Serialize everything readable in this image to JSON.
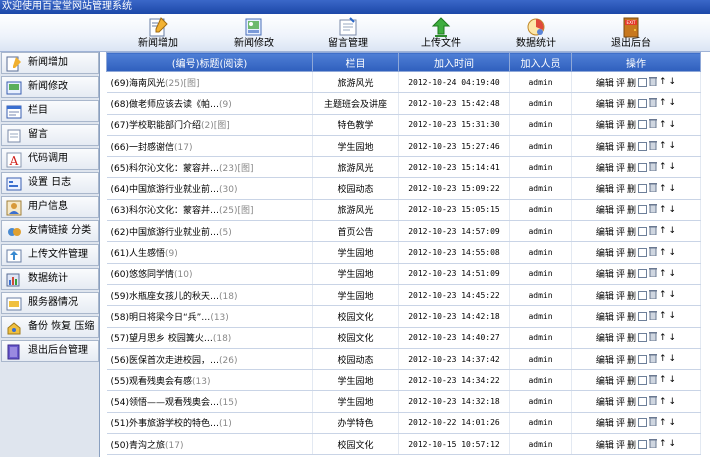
{
  "window": {
    "title": "欢迎使用百宝堂网站管理系统"
  },
  "toolbar": [
    {
      "label": "新闻增加",
      "icon": "news-add-icon"
    },
    {
      "label": "新闻修改",
      "icon": "news-edit-icon"
    },
    {
      "label": "留言管理",
      "icon": "message-icon"
    },
    {
      "label": "上传文件",
      "icon": "upload-icon"
    },
    {
      "label": "数据统计",
      "icon": "stats-icon"
    },
    {
      "label": "退出后台",
      "icon": "exit-icon",
      "badge": "EXIT"
    }
  ],
  "sidebar": [
    {
      "label": "新闻增加",
      "icon": "news-add-icon"
    },
    {
      "label": "新闻修改",
      "icon": "news-edit-icon"
    },
    {
      "label": "栏目",
      "icon": "category-icon"
    },
    {
      "label": "留言",
      "icon": "message-icon"
    },
    {
      "label": "代码调用",
      "icon": "code-icon"
    },
    {
      "label": "设置 日志",
      "icon": "settings-icon"
    },
    {
      "label": "用户信息",
      "icon": "user-icon"
    },
    {
      "label": "友情链接 分类",
      "icon": "link-icon"
    },
    {
      "label": "上传文件管理",
      "icon": "upload-icon"
    },
    {
      "label": "数据统计",
      "icon": "stats-icon"
    },
    {
      "label": "服务器情况",
      "icon": "server-icon"
    },
    {
      "label": "备份 恢复 压缩",
      "icon": "backup-icon"
    },
    {
      "label": "退出后台管理",
      "icon": "exit-icon"
    }
  ],
  "table": {
    "headers": [
      "(编号)标题(阅读)",
      "栏目",
      "加入时间",
      "加入人员",
      "操作"
    ],
    "actions": {
      "edit": "编辑",
      "comment": "评",
      "delete": "删",
      "up": "↑",
      "down": "↓"
    },
    "rows": [
      {
        "title": "(69)海南风光",
        "extra": "(25)[图]",
        "category": "旅游风光",
        "time": "2012-10-24 04:19:40",
        "user": "admin"
      },
      {
        "title": "(68)做老师应该去读《帕…",
        "extra": "(9)",
        "category": "主题班会及讲座",
        "time": "2012-10-23 15:42:48",
        "user": "admin"
      },
      {
        "title": "(67)学校职能部门介绍",
        "extra": "(2)[图]",
        "category": "特色教学",
        "time": "2012-10-23 15:31:30",
        "user": "admin"
      },
      {
        "title": "(66)一封感谢信",
        "extra": "(17)",
        "category": "学生园地",
        "time": "2012-10-23 15:27:46",
        "user": "admin"
      },
      {
        "title": "(65)科尔沁文化：蒙容并…",
        "extra": "(23)[图]",
        "category": "旅游风光",
        "time": "2012-10-23 15:14:41",
        "user": "admin"
      },
      {
        "title": "(64)中国旅游行业就业前…",
        "extra": "(30)",
        "category": "校园动态",
        "time": "2012-10-23 15:09:22",
        "user": "admin"
      },
      {
        "title": "(63)科尔沁文化：蒙容并…",
        "extra": "(25)[图]",
        "category": "旅游风光",
        "time": "2012-10-23 15:05:15",
        "user": "admin"
      },
      {
        "title": "(62)中国旅游行业就业前…",
        "extra": "(5)",
        "category": "首页公告",
        "time": "2012-10-23 14:57:09",
        "user": "admin"
      },
      {
        "title": "(61)人生感悟",
        "extra": "(9)",
        "category": "学生园地",
        "time": "2012-10-23 14:55:08",
        "user": "admin"
      },
      {
        "title": "(60)悠悠同学情",
        "extra": "(10)",
        "category": "学生园地",
        "time": "2012-10-23 14:51:09",
        "user": "admin"
      },
      {
        "title": "(59)水瓶座女孩儿的秋天…",
        "extra": "(18)",
        "category": "学生园地",
        "time": "2012-10-23 14:45:22",
        "user": "admin"
      },
      {
        "title": "(58)明日将梁今日“兵”…",
        "extra": "(13)",
        "category": "校园文化",
        "time": "2012-10-23 14:42:18",
        "user": "admin"
      },
      {
        "title": "(57)望月思乡 校园篝火…",
        "extra": "(18)",
        "category": "校园文化",
        "time": "2012-10-23 14:40:27",
        "user": "admin"
      },
      {
        "title": "(56)医保首次走进校园，…",
        "extra": "(26)",
        "category": "校园动态",
        "time": "2012-10-23 14:37:42",
        "user": "admin"
      },
      {
        "title": "(55)观看残奥会有感",
        "extra": "(13)",
        "category": "学生园地",
        "time": "2012-10-23 14:34:22",
        "user": "admin"
      },
      {
        "title": "(54)领悟——观看残奥会…",
        "extra": "(15)",
        "category": "学生园地",
        "time": "2012-10-23 14:32:18",
        "user": "admin"
      },
      {
        "title": "(51)外事旅游学校的特色…",
        "extra": "(1)",
        "category": "办学特色",
        "time": "2012-10-22 14:01:26",
        "user": "admin"
      },
      {
        "title": "(50)青沟之旅",
        "extra": "(17)",
        "category": "校园文化",
        "time": "2012-10-15 10:57:12",
        "user": "admin"
      }
    ]
  },
  "colors": {
    "title_bar": "#2a57b8",
    "header_row": "#3f6fcb",
    "sidebar_bg": "#dfe5ee"
  }
}
